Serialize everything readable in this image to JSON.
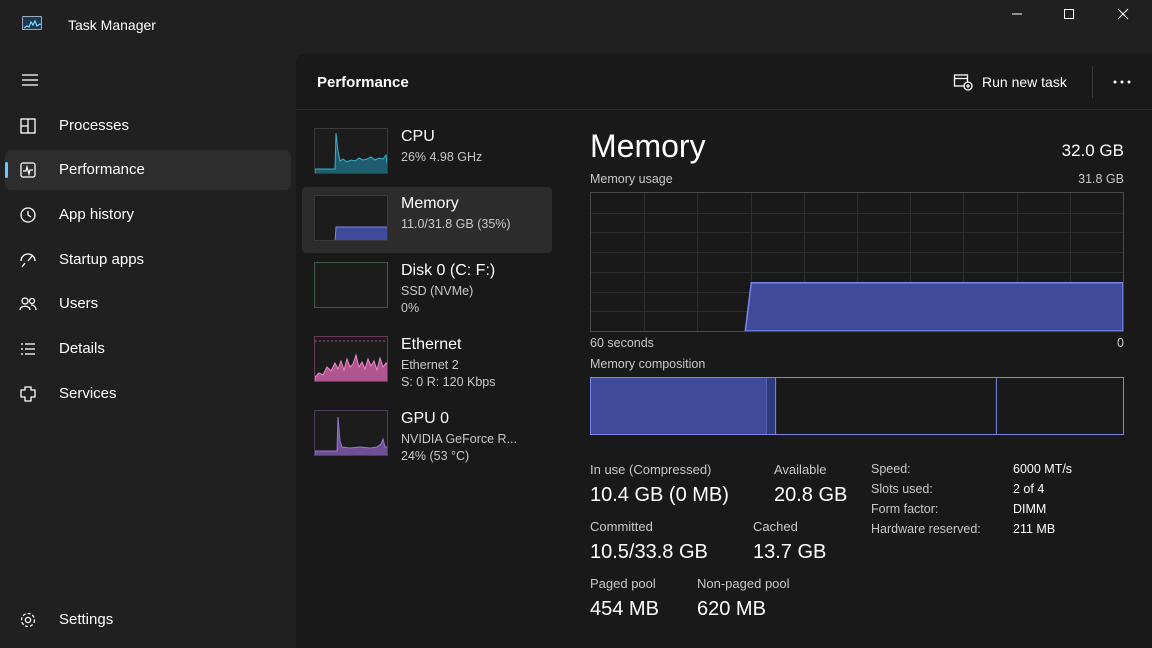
{
  "window": {
    "title": "Task Manager",
    "icon": "task-manager-app-icon",
    "controls": [
      "minimize-icon",
      "maximize-icon",
      "close-icon"
    ]
  },
  "nav": {
    "menu_icon": "hamburger-icon",
    "items": [
      {
        "label": "Processes",
        "icon": "processes-icon"
      },
      {
        "label": "Performance",
        "icon": "performance-icon",
        "active": true
      },
      {
        "label": "App history",
        "icon": "history-icon"
      },
      {
        "label": "Startup apps",
        "icon": "startup-icon"
      },
      {
        "label": "Users",
        "icon": "users-icon"
      },
      {
        "label": "Details",
        "icon": "details-icon"
      },
      {
        "label": "Services",
        "icon": "services-icon"
      }
    ],
    "settings": {
      "label": "Settings",
      "icon": "settings-icon"
    }
  },
  "header": {
    "title": "Performance",
    "run_task_label": "Run new task",
    "run_task_icon": "run-new-task-icon",
    "more_icon": "more-options-icon"
  },
  "resources": [
    {
      "name": "CPU",
      "line1": "26%  4.98 GHz",
      "color": "#34b1cf"
    },
    {
      "name": "Memory",
      "line1": "11.0/31.8 GB (35%)",
      "color": "#7d86e8",
      "active": true
    },
    {
      "name": "Disk 0 (C: F:)",
      "line1": "SSD (NVMe)",
      "line2": "0%",
      "color": "#4caf78"
    },
    {
      "name": "Ethernet",
      "line1": "Ethernet 2",
      "line2": "S: 0  R: 120 Kbps",
      "color": "#d86ab0"
    },
    {
      "name": "GPU 0",
      "line1": "NVIDIA GeForce R...",
      "line2": "24%  (53 °C)",
      "color": "#9c73d4"
    }
  ],
  "memory": {
    "title": "Memory",
    "total": "32.0 GB",
    "usage_label": "Memory usage",
    "usage_max": "31.8 GB",
    "graph_left_label": "60 seconds",
    "graph_right_label": "0",
    "usage_history_fraction": 0.35,
    "composition_label": "Memory composition",
    "composition": {
      "in_use_fraction": 0.33,
      "modified_fraction": 0.017,
      "standby_fraction": 0.415,
      "free_fraction": 0.238
    },
    "stats": {
      "in_use_label": "In use (Compressed)",
      "in_use_value": "10.4 GB (0 MB)",
      "available_label": "Available",
      "available_value": "20.8 GB",
      "committed_label": "Committed",
      "committed_value": "10.5/33.8 GB",
      "cached_label": "Cached",
      "cached_value": "13.7 GB",
      "paged_label": "Paged pool",
      "paged_value": "454 MB",
      "nonpaged_label": "Non-paged pool",
      "nonpaged_value": "620 MB"
    },
    "specs": [
      {
        "label": "Speed:",
        "value": "6000 MT/s"
      },
      {
        "label": "Slots used:",
        "value": "2 of 4"
      },
      {
        "label": "Form factor:",
        "value": "DIMM"
      },
      {
        "label": "Hardware reserved:",
        "value": "211 MB"
      }
    ]
  },
  "colors": {
    "accent": "#60cdff",
    "memory_line": "#7d86e8",
    "memory_fill": "#3f4a9a"
  }
}
